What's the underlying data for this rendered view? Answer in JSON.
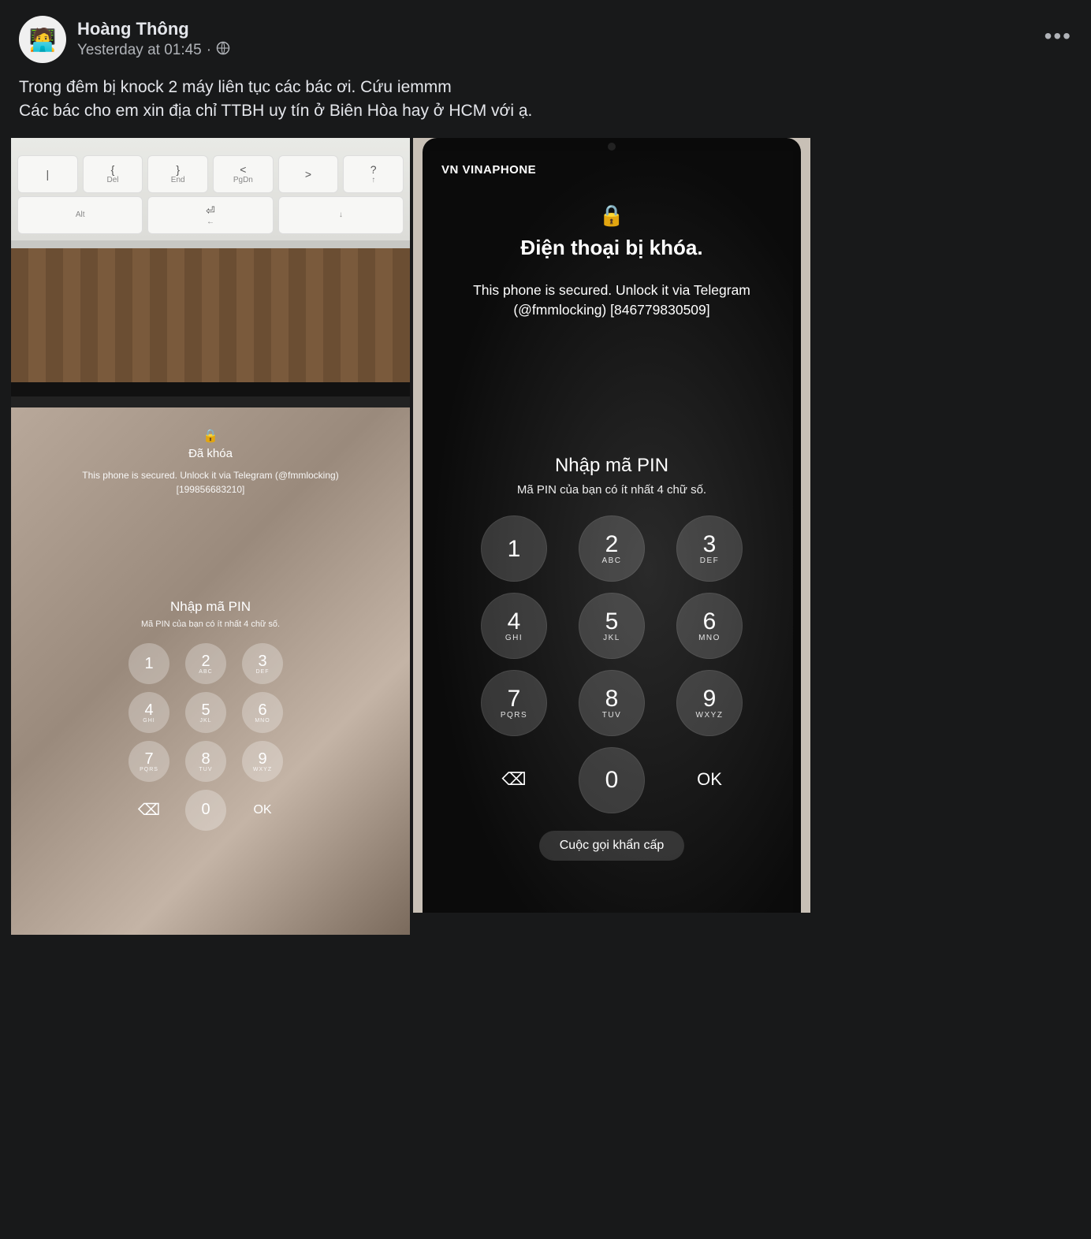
{
  "post": {
    "author": "Hoàng Thông",
    "timestamp": "Yesterday at 01:45",
    "sep": "·",
    "privacy_icon": "public-icon",
    "body_line1": "Trong đêm bị knock 2 máy liên tục các bác ơi. Cứu iemmm",
    "body_line2": "Các bác cho em xin địa chỉ TTBH uy tín ở Biên Hòa hay ở HCM với ạ.",
    "more": "•••"
  },
  "keyboard_keys_row1": [
    {
      "sym": "|",
      "lab": ""
    },
    {
      "sym": "{",
      "lab": "Del"
    },
    {
      "sym": "}",
      "lab": "End"
    },
    {
      "sym": "<",
      "lab": "PgDn"
    },
    {
      "sym": ">",
      "lab": ""
    },
    {
      "sym": "?",
      "lab": "↑"
    }
  ],
  "keyboard_keys_row2": [
    {
      "sym": "",
      "lab": "Alt"
    },
    {
      "sym": "⏎",
      "lab": "←"
    },
    {
      "sym": "",
      "lab": "↓"
    }
  ],
  "tablet": {
    "locked_title": "Đã khóa",
    "msg_line1": "This phone is secured. Unlock it via Telegram (@fmmlocking)",
    "msg_line2": "[199856683210]",
    "pin_title": "Nhập mã PIN",
    "pin_sub": "Mã PIN của bạn có ít nhất 4 chữ số.",
    "ok": "OK"
  },
  "phone": {
    "carrier": "VN VINAPHONE",
    "locked_title": "Điện thoại bị khóa.",
    "msg_line1": "This phone is secured. Unlock it via Telegram",
    "msg_line2": "(@fmmlocking) [846779830509]",
    "pin_title": "Nhập mã PIN",
    "pin_sub": "Mã PIN của bạn có ít nhất 4 chữ số.",
    "ok": "OK",
    "emergency": "Cuộc gọi khẩn cấp"
  },
  "keypad": [
    {
      "n": "1",
      "s": ""
    },
    {
      "n": "2",
      "s": "ABC"
    },
    {
      "n": "3",
      "s": "DEF"
    },
    {
      "n": "4",
      "s": "GHI"
    },
    {
      "n": "5",
      "s": "JKL"
    },
    {
      "n": "6",
      "s": "MNO"
    },
    {
      "n": "7",
      "s": "PQRS"
    },
    {
      "n": "8",
      "s": "TUV"
    },
    {
      "n": "9",
      "s": "WXYZ"
    }
  ],
  "zero": "0",
  "backspace": "⌫"
}
